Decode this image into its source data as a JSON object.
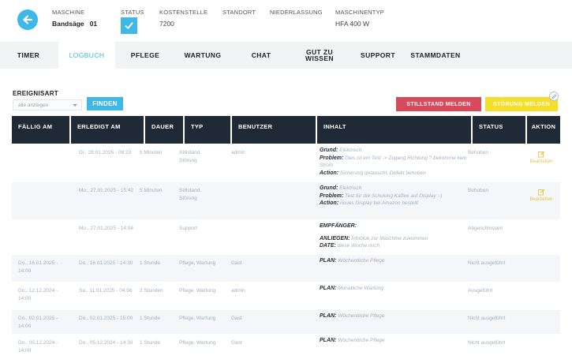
{
  "header": {
    "maschine_label": "MASCHINE",
    "maschine_value": "Bandsäge   01",
    "status_label": "STATUS",
    "kostenstelle_label": "KOSTENSTELLE",
    "kostenstelle_value": "7200",
    "standort_label": "STANDORT",
    "niederlassung_label": "NIEDERLASSUNG",
    "maschinentyp_label": "MASCHINENTYP",
    "maschinentyp_value": "HFA 400 W"
  },
  "tabs": [
    {
      "label": "TIMER"
    },
    {
      "label": "LOGBUCH"
    },
    {
      "label": "PFLEGE"
    },
    {
      "label": "WARTUNG"
    },
    {
      "label": "CHAT"
    },
    {
      "label": "GUT ZU\nWISSEN"
    },
    {
      "label": "SUPPORT"
    },
    {
      "label": "STAMMDATEN"
    }
  ],
  "filter": {
    "label": "EREIGNISART",
    "select_value": "alle anzeigen",
    "find_label": "FINDEN"
  },
  "actions": {
    "stillstand_label": "STILLSTAND MELDEN",
    "stoerung_label": "STÖRUNG MELDEN"
  },
  "columns": [
    "FÄLLIG AM",
    "ERLEDIGT AM",
    "DAUER",
    "TYP",
    "BENUTZER",
    "INHALT",
    "STATUS",
    "AKTION"
  ],
  "rows": [
    {
      "faellig": "",
      "erledigt": "Di., 28.01.2025 - 08:23",
      "dauer": "5 Minuten",
      "typ": "Stillstand, Störung",
      "benutzer": "admin",
      "inhalt": [
        {
          "k": "Grund:",
          "v": " Elektrisch"
        },
        {
          "k": "Problem:",
          "v": " Dies ist ein Test -> Zugang Richtung ? bekomme kein Strom"
        },
        {
          "k": "Action:",
          "v": " Sicherung getauscht, Defekt behoben"
        }
      ],
      "status": "Behoben",
      "aktion": "Bearbeiten"
    },
    {
      "faellig": "",
      "erledigt": "Mo., 27.01.2025 - 15:42",
      "dauer": "5 Minuten",
      "typ": "Stillstand, Störung",
      "benutzer": "",
      "inhalt": [
        {
          "k": "Grund:",
          "v": " Elektrisch"
        },
        {
          "k": "Problem:",
          "v": " Test für die Schulung Kaffee auf Display :-)"
        },
        {
          "k": "Action:",
          "v": " neues Display bei Amazon bestellt"
        }
      ],
      "status": "Behoben",
      "aktion": "Bearbeiten"
    },
    {
      "faellig": "",
      "erledigt": "Mo., 27.01.2025 - 14:04",
      "dauer": "",
      "typ": "Support",
      "benutzer": "",
      "inhalt": [
        {
          "k": "EMPFÄNGER:",
          "v": ""
        },
        {
          "k": "",
          "v": ""
        },
        {
          "k": "ANLIEGEN:",
          "v": " Infoblue zur Maschine zukommen"
        },
        {
          "k": "DATE:",
          "v": " diese Woche noch"
        }
      ],
      "status": "Abgeschlossen",
      "aktion": ""
    },
    {
      "faellig": "Do., 16.01.2025 - 14:00",
      "erledigt": "Do., 16.01.2025 - 14:30",
      "dauer": "1 Stunde",
      "typ": "Pflege, Wartung",
      "benutzer": "Gast",
      "inhalt": [
        {
          "k": "PLAN:",
          "v": "  Wöchentliche Pflege"
        }
      ],
      "status": "Nicht ausgeführt",
      "aktion": ""
    },
    {
      "faellig": "Do., 12.12.2024 - 14:00",
      "erledigt": "Sa., 11.01.2025 - 04:56",
      "dauer": "2 Stunden",
      "typ": "Pflege, Wartung",
      "benutzer": "admin",
      "inhalt": [
        {
          "k": "PLAN:",
          "v": "  Monatliche Wartung"
        }
      ],
      "status": "Ausgeführt",
      "aktion": ""
    },
    {
      "faellig": "Do., 02.01.2025 - 14:00",
      "erledigt": "Do., 02.01.2025 - 15:00",
      "dauer": "1 Stunde",
      "typ": "Pflege, Wartung",
      "benutzer": "Gast",
      "inhalt": [
        {
          "k": "PLAN:",
          "v": "  Wöchentliche Pflege"
        }
      ],
      "status": "Nicht ausgeführt",
      "aktion": ""
    },
    {
      "faellig": "Do., 05.12.2024 - 14:00",
      "erledigt": "Do., 05.12.2024 - 14:30",
      "dauer": "1 Stunde",
      "typ": "Pflege, Wartung",
      "benutzer": "Gast",
      "inhalt": [
        {
          "k": "PLAN:",
          "v": "  Wöchentliche Pflege"
        }
      ],
      "status": "Nicht ausgeführt",
      "aktion": ""
    }
  ]
}
